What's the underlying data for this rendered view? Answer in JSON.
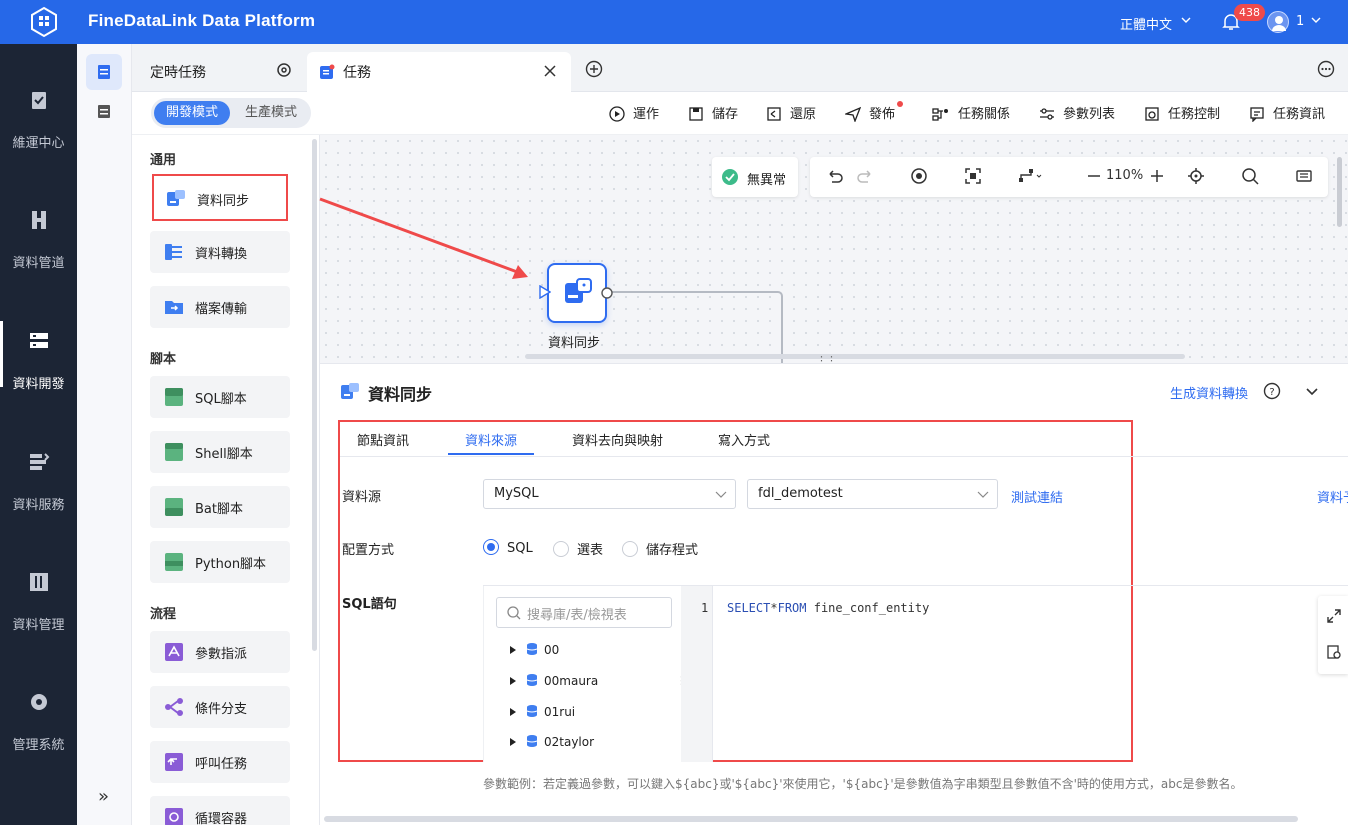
{
  "header": {
    "app_title": "FineDataLink Data Platform",
    "language": "正體中文",
    "notification_count": "438",
    "user": "1",
    "brand_color": "#2668e8"
  },
  "left_nav": [
    {
      "label": "維運中心",
      "icon": "clipboard-check-icon"
    },
    {
      "label": "資料管道",
      "icon": "pipeline-icon"
    },
    {
      "label": "資料開發",
      "icon": "data-dev-icon",
      "active": true
    },
    {
      "label": "資料服務",
      "icon": "data-service-icon"
    },
    {
      "label": "資料管理",
      "icon": "data-manage-icon"
    },
    {
      "label": "管理系統",
      "icon": "gear-icon"
    }
  ],
  "tabs": {
    "scheduled": "定時任務",
    "task": "任務"
  },
  "mode": {
    "dev": "開發模式",
    "prod": "生產模式"
  },
  "toolbar": {
    "run": "運作",
    "save": "儲存",
    "restore": "還原",
    "publish": "發佈",
    "relations": "任務關係",
    "params": "參數列表",
    "control": "任務控制",
    "info": "任務資訊"
  },
  "components": {
    "general_title": "通用",
    "general": [
      "資料同步",
      "資料轉換",
      "檔案傳輸"
    ],
    "script_title": "腳本",
    "scripts": [
      "SQL腳本",
      "Shell腳本",
      "Bat腳本",
      "Python腳本"
    ],
    "flow_title": "流程",
    "flows": [
      "參數指派",
      "條件分支",
      "呼叫任務",
      "循環容器"
    ]
  },
  "canvas": {
    "status": "無異常",
    "zoom": "110%",
    "node_label": "資料同步"
  },
  "panel": {
    "title": "資料同步",
    "generate_link": "生成資料轉換",
    "subtabs": [
      "節點資訊",
      "資料來源",
      "資料去向與映射",
      "寫入方式"
    ],
    "active_subtab": "資料來源",
    "datasource_label": "資料源",
    "datasource_type": "MySQL",
    "datasource_conn": "fdl_demotest",
    "test_conn": "測試連結",
    "right_cut_link": "資料予",
    "config_label": "配置方式",
    "config_options": [
      "SQL",
      "選表",
      "儲存程式"
    ],
    "config_selected": "SQL",
    "sql_label": "SQL語句",
    "tree_search_placeholder": "搜尋庫/表/檢視表",
    "tree_items": [
      "00",
      "00maura",
      "01rui",
      "02taylor"
    ],
    "line_number": "1",
    "sql_kw1": "SELECT",
    "sql_star": "*",
    "sql_kw2": "FROM",
    "sql_rest": " fine_conf_entity",
    "hint": "參數範例：若定義過參數，可以鍵入${abc}或'${abc}'來使用它，'${abc}'是參數值為字串類型且參數值不含'時的使用方式，abc是參數名。"
  }
}
